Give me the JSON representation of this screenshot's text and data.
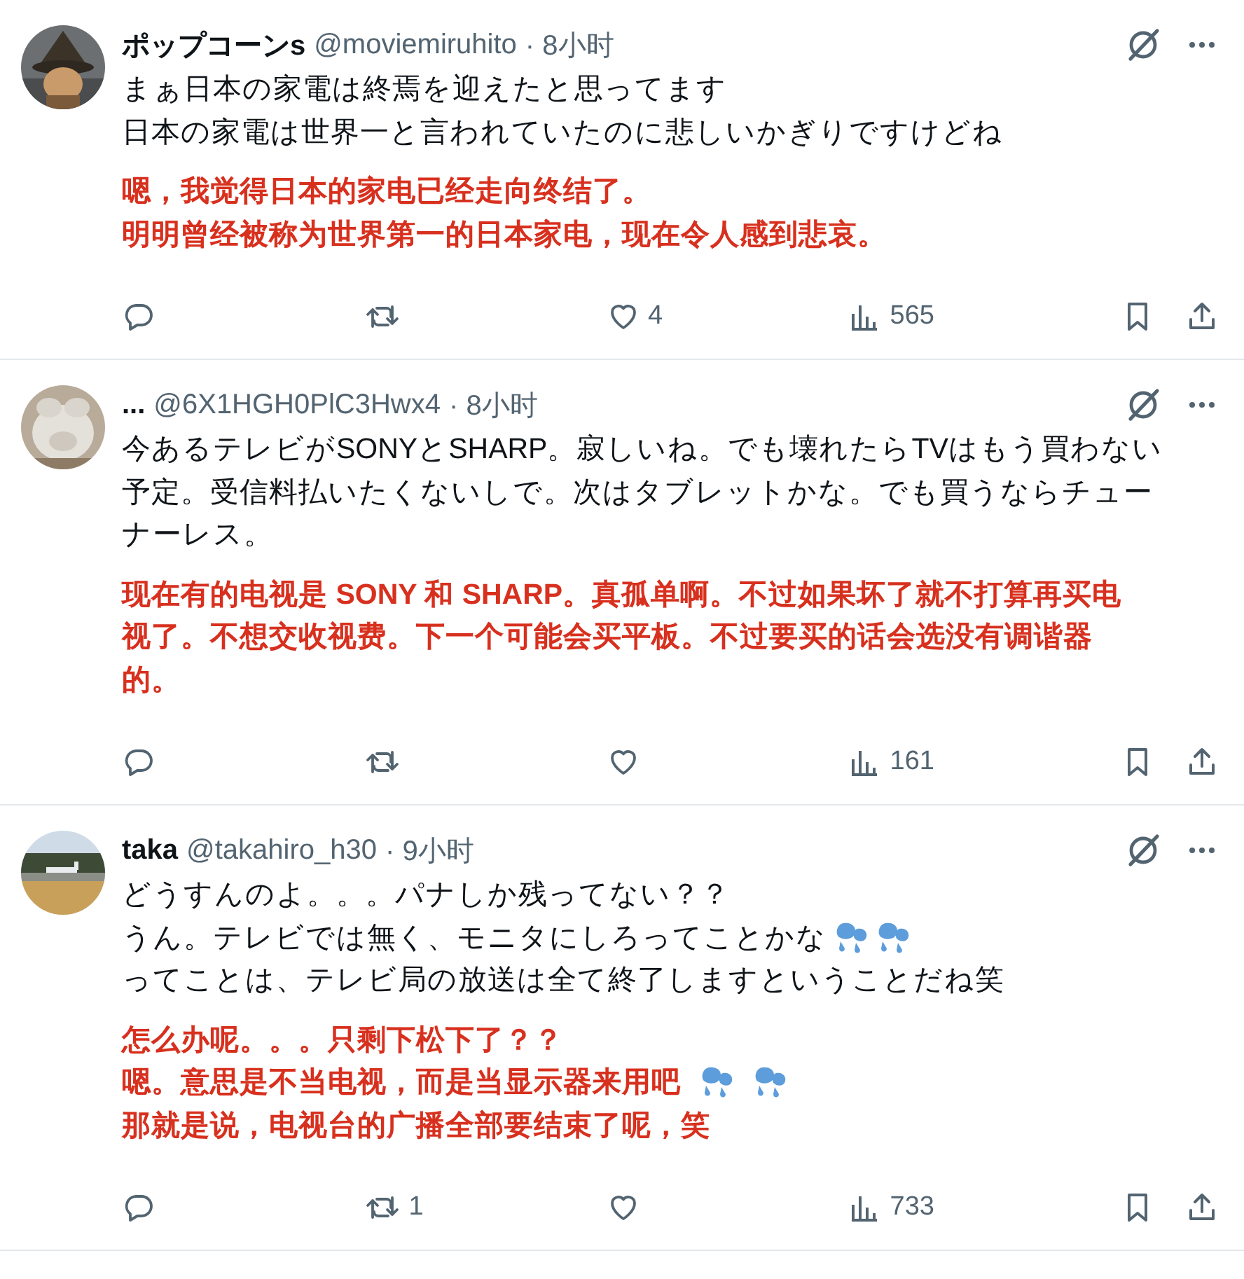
{
  "posts": [
    {
      "display_name": "ポップコーンs",
      "handle": "@moviemiruhito",
      "time": "· 8小时",
      "avatar": {
        "kind": "picture"
      },
      "text_lines": [
        {
          "text": "まぁ日本の家電は終焉を迎えたと思ってます"
        },
        {
          "text": "日本の家電は世界一と言われていたのに悲しいかぎりですけどね"
        }
      ],
      "translation_lines": [
        {
          "text": "嗯，我觉得日本的家电已经走向终结了。"
        },
        {
          "text": "明明曾经被称为世界第一的日本家电，现在令人感到悲哀。"
        }
      ],
      "like_count": "4",
      "view_count": "565"
    },
    {
      "display_name": "...",
      "handle": "@6X1HGH0PlC3Hwx4",
      "time": "· 8小时",
      "avatar": {
        "kind": "picture"
      },
      "text_lines": [
        {
          "text": "今あるテレビがSONYとSHARP。寂しいね。でも壊れたらTVはもう買わない"
        },
        {
          "text": "予定。受信料払いたくないしで。次はタブレットかな。でも買うならチュー"
        },
        {
          "text": "ナーレス。"
        }
      ],
      "translation_lines": [
        {
          "text": "现在有的电视是 SONY 和 SHARP。真孤单啊。不过如果坏了就不打算再买电"
        },
        {
          "text": "视了。不想交收视费。下一个可能会买平板。不过要买的话会选没有调谐器"
        },
        {
          "text": "的。"
        }
      ],
      "view_count": "161"
    },
    {
      "display_name": "taka",
      "handle": "@takahiro_h30",
      "time": "· 9小时",
      "avatar": {
        "kind": "picture"
      },
      "text_lines": [
        {
          "text": "どうすんのよ。。。パナしか残ってない？？"
        },
        {
          "text": "うん。テレビでは無く、モニタにしろってことかな",
          "icons": [
            {
              "kind": "sweat"
            },
            {
              "kind": "sweat"
            }
          ]
        },
        {
          "text": "ってことは、テレビ局の放送は全て終了しますということだね笑"
        }
      ],
      "translation_lines": [
        {
          "text": "怎么办呢。。。只剩下松下了？？"
        },
        {
          "text": "嗯。意思是不当电视，而是当显示器来用吧",
          "icons": [
            {
              "kind": "sweat"
            },
            {
              "kind": "sweat"
            }
          ]
        },
        {
          "text": "那就是说，电视台的广播全部要结束了呢，笑"
        }
      ],
      "repost_count": "1",
      "view_count": "733"
    }
  ]
}
